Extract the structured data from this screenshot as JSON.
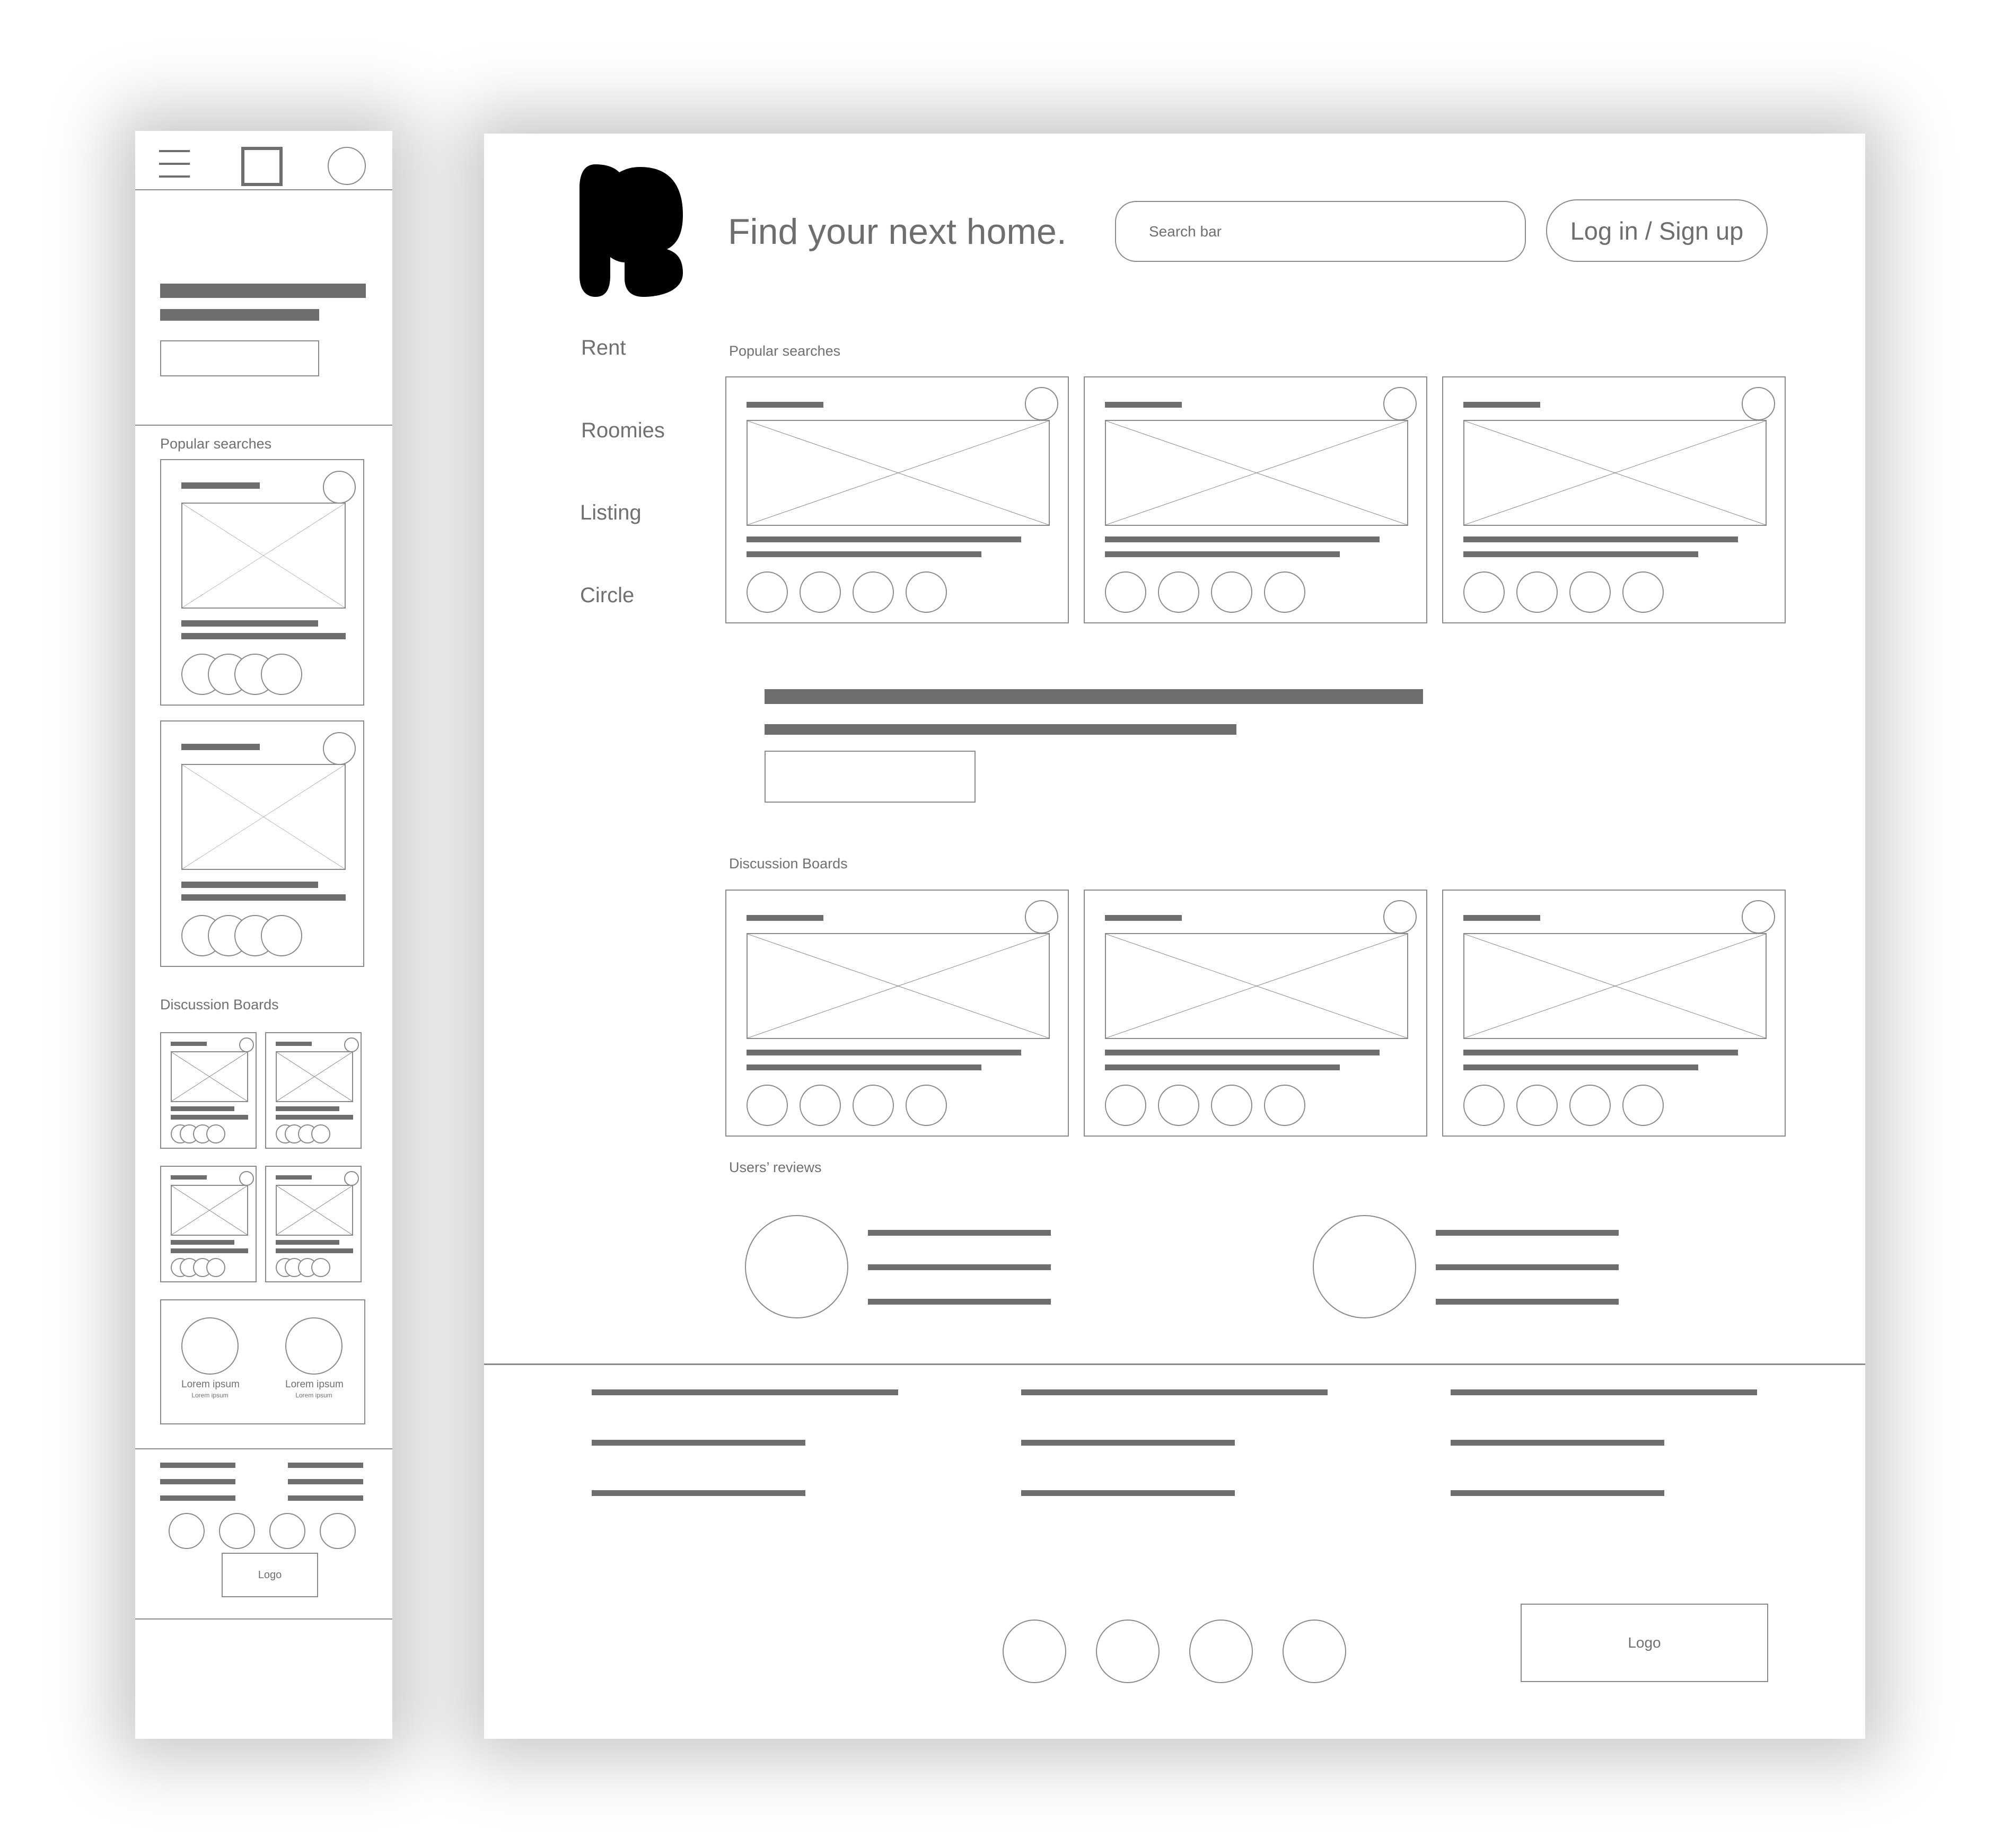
{
  "mobile": {
    "header": {
      "menu_icon": "hamburger-icon",
      "logo_icon": "square-logo-icon",
      "profile_icon": "avatar-circle-icon"
    },
    "popular_searches_label": "Popular searches",
    "discussion_boards_label": "Discussion Boards",
    "reviews": [
      {
        "name": "Lorem ipsum",
        "subtitle": "Lorem ipsum"
      },
      {
        "name": "Lorem ipsum",
        "subtitle": "Lorem ipsum"
      }
    ],
    "footer": {
      "logo_label": "Logo"
    }
  },
  "desktop": {
    "brand": {
      "logo_letter": "R"
    },
    "headline": "Find your next home.",
    "search": {
      "placeholder": "Search bar"
    },
    "auth_button": "Log in / Sign up",
    "nav": [
      {
        "label": "Rent"
      },
      {
        "label": "Roomies"
      },
      {
        "label": "Listing"
      },
      {
        "label": "Circle"
      }
    ],
    "popular_searches_label": "Popular searches",
    "discussion_boards_label": "Discussion Boards",
    "users_reviews_label": "Users’ reviews",
    "footer": {
      "logo_label": "Logo"
    }
  }
}
